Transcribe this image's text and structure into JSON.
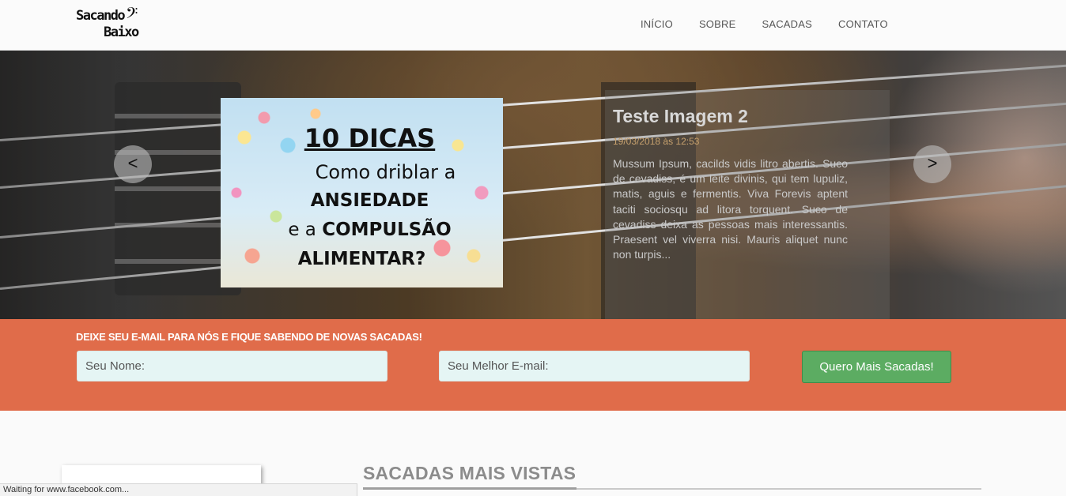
{
  "header": {
    "logo_line1": "Sacando",
    "logo_line2": "Baixo",
    "nav": [
      "INÍCIO",
      "SOBRE",
      "SACADAS",
      "CONTATO"
    ]
  },
  "carousel": {
    "image_text": {
      "line1": "10 DICAS",
      "line2": "Como driblar a",
      "line3": "ANSIEDADE",
      "line4_prefix": "e a ",
      "line4_bold": "COMPULSÃO",
      "line5": "ALIMENTAR?"
    },
    "title": "Teste Imagem 2",
    "date": "19/03/2018 às 12:53",
    "description": "Mussum Ipsum, cacilds vidis litro abertis. Suco de cevadiss, é um leite divinis, qui tem lupuliz, matis, aguis e fermentis. Viva Forevis aptent taciti sociosqu ad litora torquent. Suco de cevadiss deixa as pessoas mais interessantis. Praesent vel viverra nisi. Mauris aliquet nunc non turpis...",
    "prev_label": "<",
    "next_label": ">"
  },
  "subscribe": {
    "heading": "DEIXE SEU E-MAIL PARA NÓS E FIQUE SABENDO DE NOVAS SACADAS!",
    "name_placeholder": "Seu Nome:",
    "email_placeholder": "Seu Melhor E-mail:",
    "button_label": "Quero Mais Sacadas!"
  },
  "section": {
    "title": "SACADAS MAIS VISTAS"
  },
  "statusbar": {
    "text": "Waiting for www.facebook.com..."
  },
  "colors": {
    "subscribe_bg": "#e06c4a",
    "button_bg": "#5cac62",
    "date_color": "#c7a16e"
  }
}
